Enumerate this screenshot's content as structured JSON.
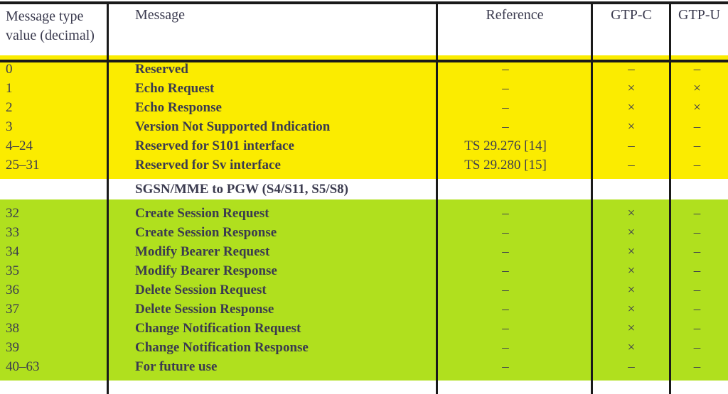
{
  "table": {
    "columns": [
      {
        "key": "value",
        "label": "Message type\nvalue (decimal)",
        "label_line1": "Message type",
        "label_line2": "value (decimal)"
      },
      {
        "key": "message",
        "label": "Message"
      },
      {
        "key": "reference",
        "label": "Reference"
      },
      {
        "key": "gtpc",
        "label": "GTP-C"
      },
      {
        "key": "gtpu",
        "label": "GTP-U"
      }
    ],
    "headers": {
      "value_line1": "Message type",
      "value_line2": "value (decimal)",
      "message": "Message",
      "reference": "Reference",
      "gtpc": "GTP-C",
      "gtpu": "GTP-U"
    },
    "symbols": {
      "dash": "–",
      "cross": "×"
    },
    "colors": {
      "yellow": "#fbec00",
      "green": "#b0e01e",
      "white": "#ffffff",
      "rule": "#1a1a1a",
      "text": "#3b3b4f"
    },
    "sections": [
      {
        "id": "section-reserved",
        "style": "yellow",
        "heading": null,
        "rows": [
          {
            "value": "0",
            "message": "Reserved",
            "reference": "–",
            "gtpc": "–",
            "gtpu": "–"
          },
          {
            "value": "1",
            "message": "Echo Request",
            "reference": "–",
            "gtpc": "×",
            "gtpu": "×"
          },
          {
            "value": "2",
            "message": "Echo Response",
            "reference": "–",
            "gtpc": "×",
            "gtpu": "×"
          },
          {
            "value": "3",
            "message": "Version Not Supported Indication",
            "reference": "–",
            "gtpc": "×",
            "gtpu": "–"
          },
          {
            "value": "4–24",
            "message": "Reserved for S101 interface",
            "reference": "TS 29.276 [14]",
            "gtpc": "–",
            "gtpu": "–"
          },
          {
            "value": "25–31",
            "message": "Reserved for Sv interface",
            "reference": "TS 29.280 [15]",
            "gtpc": "–",
            "gtpu": "–"
          }
        ]
      },
      {
        "id": "section-sgsn-mme-to-pgw",
        "style": "green",
        "heading": "SGSN/MME to PGW (S4/S11, S5/S8)",
        "rows": [
          {
            "value": "32",
            "message": "Create Session Request",
            "reference": "–",
            "gtpc": "×",
            "gtpu": "–"
          },
          {
            "value": "33",
            "message": "Create Session Response",
            "reference": "–",
            "gtpc": "×",
            "gtpu": "–"
          },
          {
            "value": "34",
            "message": "Modify Bearer Request",
            "reference": "–",
            "gtpc": "×",
            "gtpu": "–"
          },
          {
            "value": "35",
            "message": "Modify Bearer Response",
            "reference": "–",
            "gtpc": "×",
            "gtpu": "–"
          },
          {
            "value": "36",
            "message": "Delete Session Request",
            "reference": "–",
            "gtpc": "×",
            "gtpu": "–"
          },
          {
            "value": "37",
            "message": "Delete Session Response",
            "reference": "–",
            "gtpc": "×",
            "gtpu": "–"
          },
          {
            "value": "38",
            "message": "Change Notification Request",
            "reference": "–",
            "gtpc": "×",
            "gtpu": "–"
          },
          {
            "value": "39",
            "message": "Change Notification Response",
            "reference": "–",
            "gtpc": "×",
            "gtpu": "–"
          },
          {
            "value": "40–63",
            "message": "For future use",
            "reference": "–",
            "gtpc": "–",
            "gtpu": "–"
          }
        ]
      }
    ]
  }
}
